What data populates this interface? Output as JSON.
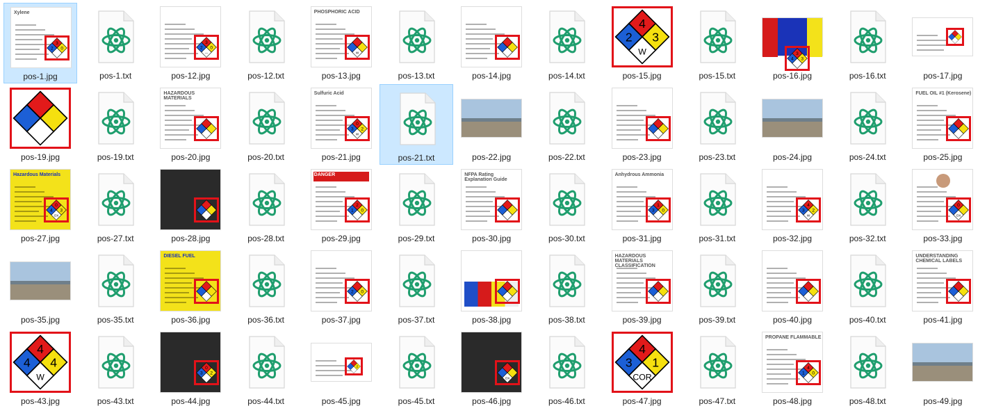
{
  "window": {
    "selected_files": [
      "pos-1.jpg",
      "pos-21.txt"
    ]
  },
  "colors": {
    "selection": "#cce8ff",
    "selection_border": "#99d1ff",
    "highlight_box": "#e21219",
    "atom_icon": "#1f9e6e",
    "nfpa_blue": "#1c5fd6",
    "nfpa_red": "#e21a1a",
    "nfpa_yellow": "#f5e00f",
    "nfpa_white": "#ffffff"
  },
  "files": [
    {
      "name": "pos-1.jpg",
      "type": "image",
      "icon": "image-thumbnail",
      "thumb": "doc",
      "caption": "Xylene",
      "nfpa": [
        "3",
        "2",
        "0",
        ""
      ]
    },
    {
      "name": "pos-1.txt",
      "type": "text",
      "icon": "atom-file-icon"
    },
    {
      "name": "pos-12.jpg",
      "type": "image",
      "icon": "image-thumbnail",
      "thumb": "doc",
      "nfpa": [
        "3",
        "2",
        "0",
        "—"
      ]
    },
    {
      "name": "pos-12.txt",
      "type": "text",
      "icon": "atom-file-icon"
    },
    {
      "name": "pos-13.jpg",
      "type": "image",
      "icon": "image-thumbnail",
      "thumb": "doc",
      "caption": "PHOSPHORIC ACID",
      "nfpa": [
        "",
        "",
        "",
        "W"
      ]
    },
    {
      "name": "pos-13.txt",
      "type": "text",
      "icon": "atom-file-icon"
    },
    {
      "name": "pos-14.jpg",
      "type": "image",
      "icon": "image-thumbnail",
      "thumb": "doc",
      "nfpa": [
        "",
        "",
        "",
        ""
      ]
    },
    {
      "name": "pos-14.txt",
      "type": "text",
      "icon": "atom-file-icon"
    },
    {
      "name": "pos-15.jpg",
      "type": "image",
      "icon": "image-thumbnail",
      "thumb": "big",
      "nfpa": [
        "4",
        "2",
        "3",
        "W"
      ]
    },
    {
      "name": "pos-15.txt",
      "type": "text",
      "icon": "atom-file-icon"
    },
    {
      "name": "pos-16.jpg",
      "type": "image",
      "icon": "image-thumbnail",
      "thumb": "panel",
      "nfpa": [
        "3",
        "4",
        "3",
        ""
      ]
    },
    {
      "name": "pos-16.txt",
      "type": "text",
      "icon": "atom-file-icon"
    },
    {
      "name": "pos-17.jpg",
      "type": "image",
      "icon": "image-thumbnail",
      "thumb": "table",
      "nfpa": [
        "",
        "",
        "",
        ""
      ]
    },
    {
      "name": "pos-19.jpg",
      "type": "image",
      "icon": "image-thumbnail",
      "thumb": "big",
      "nfpa": [
        "",
        "",
        "",
        ""
      ]
    },
    {
      "name": "pos-19.txt",
      "type": "text",
      "icon": "atom-file-icon"
    },
    {
      "name": "pos-20.jpg",
      "type": "image",
      "icon": "image-thumbnail",
      "thumb": "doc",
      "caption": "HAZARDOUS MATERIALS",
      "nfpa": [
        "",
        "",
        "",
        ""
      ]
    },
    {
      "name": "pos-20.txt",
      "type": "text",
      "icon": "atom-file-icon"
    },
    {
      "name": "pos-21.jpg",
      "type": "image",
      "icon": "image-thumbnail",
      "thumb": "doc",
      "caption": "Sulfuric Acid",
      "nfpa": [
        "0",
        "3",
        "2",
        "W"
      ]
    },
    {
      "name": "pos-21.txt",
      "type": "text",
      "icon": "atom-file-icon"
    },
    {
      "name": "pos-22.jpg",
      "type": "image",
      "icon": "image-thumbnail",
      "thumb": "photo"
    },
    {
      "name": "pos-22.txt",
      "type": "text",
      "icon": "atom-file-icon"
    },
    {
      "name": "pos-23.jpg",
      "type": "image",
      "icon": "image-thumbnail",
      "thumb": "doc",
      "nfpa": [
        "",
        "",
        "",
        ""
      ]
    },
    {
      "name": "pos-23.txt",
      "type": "text",
      "icon": "atom-file-icon"
    },
    {
      "name": "pos-24.jpg",
      "type": "image",
      "icon": "image-thumbnail",
      "thumb": "photo"
    },
    {
      "name": "pos-24.txt",
      "type": "text",
      "icon": "atom-file-icon"
    },
    {
      "name": "pos-25.jpg",
      "type": "image",
      "icon": "image-thumbnail",
      "thumb": "doc",
      "caption": "FUEL OIL #1 (Kerosene)",
      "nfpa": [
        "",
        "",
        "",
        ""
      ]
    },
    {
      "name": "pos-27.jpg",
      "type": "image",
      "icon": "image-thumbnail",
      "thumb": "yellow",
      "caption": "Hazardous Materials",
      "nfpa": [
        "0",
        "4",
        "3",
        "OX"
      ]
    },
    {
      "name": "pos-27.txt",
      "type": "text",
      "icon": "atom-file-icon"
    },
    {
      "name": "pos-28.jpg",
      "type": "image",
      "icon": "image-thumbnail",
      "thumb": "dark",
      "nfpa": [
        "",
        "",
        "",
        ""
      ]
    },
    {
      "name": "pos-28.txt",
      "type": "text",
      "icon": "atom-file-icon"
    },
    {
      "name": "pos-29.jpg",
      "type": "image",
      "icon": "image-thumbnail",
      "thumb": "danger",
      "caption": "DANGER",
      "nfpa": [
        "2",
        "1",
        "0",
        ""
      ]
    },
    {
      "name": "pos-29.txt",
      "type": "text",
      "icon": "atom-file-icon"
    },
    {
      "name": "pos-30.jpg",
      "type": "image",
      "icon": "image-thumbnail",
      "thumb": "doc",
      "caption": "NFPA Rating Explanation Guide",
      "nfpa": [
        "",
        "",
        "",
        ""
      ]
    },
    {
      "name": "pos-30.txt",
      "type": "text",
      "icon": "atom-file-icon"
    },
    {
      "name": "pos-31.jpg",
      "type": "image",
      "icon": "image-thumbnail",
      "thumb": "doc",
      "caption": "Anhydrous Ammonia",
      "nfpa": [
        "1",
        "3",
        "0",
        ""
      ]
    },
    {
      "name": "pos-31.txt",
      "type": "text",
      "icon": "atom-file-icon"
    },
    {
      "name": "pos-32.jpg",
      "type": "image",
      "icon": "image-thumbnail",
      "thumb": "doc",
      "nfpa": [
        "4",
        "3",
        "2",
        "W"
      ]
    },
    {
      "name": "pos-32.txt",
      "type": "text",
      "icon": "atom-file-icon"
    },
    {
      "name": "pos-33.jpg",
      "type": "image",
      "icon": "image-thumbnail",
      "thumb": "person",
      "nfpa": [
        "0",
        "",
        "",
        "OX"
      ]
    },
    {
      "name": "pos-35.jpg",
      "type": "image",
      "icon": "image-thumbnail",
      "thumb": "photo"
    },
    {
      "name": "pos-35.txt",
      "type": "text",
      "icon": "atom-file-icon"
    },
    {
      "name": "pos-36.jpg",
      "type": "image",
      "icon": "image-thumbnail",
      "thumb": "yellow",
      "caption": "DIESEL FUEL",
      "nfpa": [
        "",
        "",
        "",
        ""
      ]
    },
    {
      "name": "pos-36.txt",
      "type": "text",
      "icon": "atom-file-icon"
    },
    {
      "name": "pos-37.jpg",
      "type": "image",
      "icon": "image-thumbnail",
      "thumb": "doc",
      "nfpa": [
        "",
        "2",
        "0",
        ""
      ]
    },
    {
      "name": "pos-37.txt",
      "type": "text",
      "icon": "atom-file-icon"
    },
    {
      "name": "pos-38.jpg",
      "type": "image",
      "icon": "image-thumbnail",
      "thumb": "chart",
      "nfpa": [
        "",
        "",
        "",
        ""
      ]
    },
    {
      "name": "pos-38.txt",
      "type": "text",
      "icon": "atom-file-icon"
    },
    {
      "name": "pos-39.jpg",
      "type": "image",
      "icon": "image-thumbnail",
      "thumb": "doc",
      "caption": "HAZARDOUS MATERIALS CLASSIFICATION",
      "nfpa": [
        "",
        "",
        "",
        ""
      ]
    },
    {
      "name": "pos-39.txt",
      "type": "text",
      "icon": "atom-file-icon"
    },
    {
      "name": "pos-40.jpg",
      "type": "image",
      "icon": "image-thumbnail",
      "thumb": "doc",
      "nfpa": [
        "",
        "",
        "",
        ""
      ]
    },
    {
      "name": "pos-40.txt",
      "type": "text",
      "icon": "atom-file-icon"
    },
    {
      "name": "pos-41.jpg",
      "type": "image",
      "icon": "image-thumbnail",
      "thumb": "doc",
      "caption": "UNDERSTANDING CHEMICAL LABELS",
      "nfpa": [
        "",
        "",
        "",
        ""
      ]
    },
    {
      "name": "pos-43.jpg",
      "type": "image",
      "icon": "image-thumbnail",
      "thumb": "big",
      "nfpa": [
        "4",
        "4",
        "4",
        "W"
      ]
    },
    {
      "name": "pos-43.txt",
      "type": "text",
      "icon": "atom-file-icon"
    },
    {
      "name": "pos-44.jpg",
      "type": "image",
      "icon": "image-thumbnail",
      "thumb": "dark",
      "nfpa": [
        "0",
        "3",
        "2",
        ""
      ]
    },
    {
      "name": "pos-44.txt",
      "type": "text",
      "icon": "atom-file-icon"
    },
    {
      "name": "pos-45.jpg",
      "type": "image",
      "icon": "image-thumbnail",
      "thumb": "card",
      "nfpa": [
        "",
        "",
        "2",
        ""
      ]
    },
    {
      "name": "pos-45.txt",
      "type": "text",
      "icon": "atom-file-icon"
    },
    {
      "name": "pos-46.jpg",
      "type": "image",
      "icon": "image-thumbnail",
      "thumb": "dark",
      "nfpa": [
        "",
        "",
        "",
        "OX"
      ]
    },
    {
      "name": "pos-46.txt",
      "type": "text",
      "icon": "atom-file-icon"
    },
    {
      "name": "pos-47.jpg",
      "type": "image",
      "icon": "image-thumbnail",
      "thumb": "big",
      "nfpa": [
        "4",
        "3",
        "1",
        "COR"
      ]
    },
    {
      "name": "pos-47.txt",
      "type": "text",
      "icon": "atom-file-icon"
    },
    {
      "name": "pos-48.jpg",
      "type": "image",
      "icon": "image-thumbnail",
      "thumb": "doc",
      "caption": "PROPANE FLAMMABLE",
      "nfpa": [
        "4",
        "1",
        "0",
        ""
      ]
    },
    {
      "name": "pos-48.txt",
      "type": "text",
      "icon": "atom-file-icon"
    },
    {
      "name": "pos-49.jpg",
      "type": "image",
      "icon": "image-thumbnail",
      "thumb": "photo"
    }
  ]
}
